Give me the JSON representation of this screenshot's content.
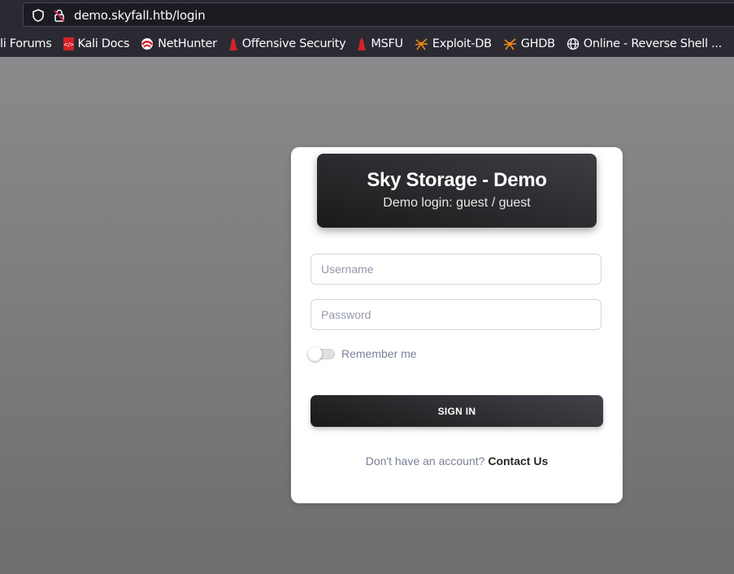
{
  "browser": {
    "url": "demo.skyfall.htb/login",
    "bookmarks": [
      {
        "label": "li Forums",
        "icon": "none"
      },
      {
        "label": "Kali Docs",
        "icon": "kali-docs-icon"
      },
      {
        "label": "NetHunter",
        "icon": "nethunter-icon"
      },
      {
        "label": "Offensive Security",
        "icon": "offsec-icon"
      },
      {
        "label": "MSFU",
        "icon": "offsec-icon"
      },
      {
        "label": "Exploit-DB",
        "icon": "exploitdb-icon"
      },
      {
        "label": "GHDB",
        "icon": "exploitdb-icon"
      },
      {
        "label": "Online - Reverse Shell ...",
        "icon": "globe-icon"
      }
    ]
  },
  "login": {
    "title": "Sky Storage - Demo",
    "subtitle": "Demo login: guest / guest",
    "username_placeholder": "Username",
    "password_placeholder": "Password",
    "remember_label": "Remember me",
    "signin_label": "SIGN IN",
    "no_account_text": "Don't have an account?",
    "contact_label": "Contact Us"
  }
}
